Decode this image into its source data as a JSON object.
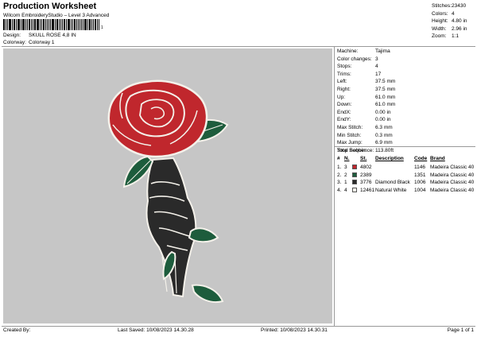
{
  "header": {
    "title": "Production Worksheet",
    "software": "Wilcom EmbroideryStudio – Level 3 Advanced",
    "barcode_suffix": "1",
    "design_label": "Design:",
    "design_value": "SKULL ROSE 4,8 IN",
    "colorway_label": "Colorway:",
    "colorway_value": "Colorway 1"
  },
  "stats": [
    {
      "label": "Stitches:",
      "value": "23430"
    },
    {
      "label": "Colors:",
      "value": "4"
    },
    {
      "label": "Height:",
      "value": "4.80 in"
    },
    {
      "label": "Width:",
      "value": "2.96 in"
    },
    {
      "label": "Zoom:",
      "value": "1:1"
    }
  ],
  "machine_info": [
    {
      "label": "Machine:",
      "value": "Tajima"
    },
    {
      "label": "Color changes:",
      "value": "3"
    },
    {
      "label": "Stops:",
      "value": "4"
    },
    {
      "label": "Trims:",
      "value": "17"
    },
    {
      "label": "Left:",
      "value": "37.5 mm"
    },
    {
      "label": "Right:",
      "value": "37.5 mm"
    },
    {
      "label": "Up:",
      "value": "61.0 mm"
    },
    {
      "label": "Down:",
      "value": "61.0 mm"
    },
    {
      "label": "EndX:",
      "value": "0.00 in"
    },
    {
      "label": "EndY:",
      "value": "0.00 in"
    },
    {
      "label": "Max Stitch:",
      "value": "6.3 mm"
    },
    {
      "label": "Min Stitch:",
      "value": "0.3 mm"
    },
    {
      "label": "Max Jump:",
      "value": "6.9 mm"
    },
    {
      "label": "Total Bobbin:",
      "value": "113.80ft"
    }
  ],
  "stop_sequence": {
    "title": "Stop Sequence:",
    "headers": {
      "hash": "#",
      "n": "N.",
      "st": "St.",
      "description": "Description",
      "code": "Code",
      "brand": "Brand"
    },
    "rows": [
      {
        "num": "1.",
        "step": "3",
        "color": "#c0272d",
        "stitches": "4802",
        "description": "",
        "code": "1146",
        "brand": "Madeira Classic 40"
      },
      {
        "num": "2.",
        "step": "2",
        "color": "#1d5c3c",
        "stitches": "2389",
        "description": "",
        "code": "1351",
        "brand": "Madeira Classic 40"
      },
      {
        "num": "3.",
        "step": "1",
        "color": "#2a2a2a",
        "stitches": "3776",
        "description": "Diamond Black",
        "code": "1006",
        "brand": "Madeira Classic 40"
      },
      {
        "num": "4.",
        "step": "4",
        "color": "#f4f1ea",
        "stitches": "12461",
        "description": "Natural White",
        "code": "1004",
        "brand": "Madeira Classic 40"
      }
    ]
  },
  "footer": {
    "created_by": "Created By:",
    "last_saved": "Last Saved: 10/08/2023 14.30.28",
    "printed": "Printed: 10/08/2023 14.30.31",
    "page": "Page 1 of 1"
  },
  "colors": {
    "canvas": "#c6c6c6",
    "rose_red": "#c0272d",
    "leaf_green": "#1d5c3c",
    "hand_black": "#2a2a2a",
    "outline_white": "#f4f1ea"
  }
}
